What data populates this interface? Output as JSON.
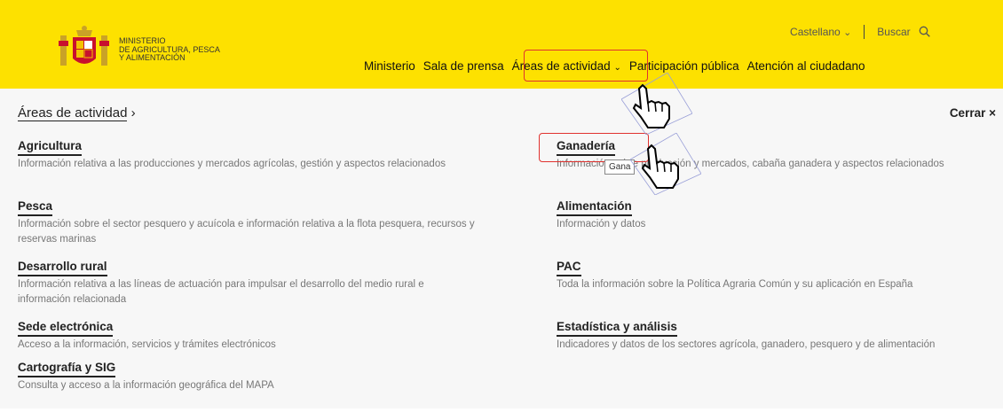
{
  "header": {
    "logo_lines": [
      "MINISTERIO",
      "DE AGRICULTURA, PESCA",
      "Y ALIMENTACIÓN"
    ],
    "language": "Castellano",
    "search": "Buscar",
    "nav": [
      "Ministerio",
      "Sala de prensa",
      "Áreas de actividad",
      "Participación pública",
      "Atención al ciudadano"
    ]
  },
  "panel": {
    "breadcrumb": "Áreas de actividad",
    "close": "Cerrar",
    "left": [
      {
        "title": "Agricultura",
        "desc": "Información relativa a las producciones y mercados agrícolas, gestión y aspectos relacionados"
      },
      {
        "title": "Pesca",
        "desc": "Información sobre el sector pesquero y acuícola e información relativa a la flota pesquera, recursos y reservas marinas"
      },
      {
        "title": "Desarrollo rural",
        "desc": "Información relativa a las líneas de actuación para impulsar el desarrollo del medio rural e información relacionada"
      },
      {
        "title": "Sede electrónica",
        "desc": "Acceso a la información, servicios y trámites electrónicos"
      },
      {
        "title": "Cartografía y SIG",
        "desc": "Consulta y acceso a la información geográfica del MAPA"
      }
    ],
    "right": [
      {
        "title": "Ganadería",
        "desc": "Información sobre producción y mercados, cabaña ganadera y aspectos relacionados"
      },
      {
        "title": "Alimentación",
        "desc": "Información y datos"
      },
      {
        "title": "PAC",
        "desc": "Toda la información sobre la Política Agraria Común y su aplicación en España"
      },
      {
        "title": "Estadística y análisis",
        "desc": "Indicadores y datos de los sectores agrícola, ganadero, pesquero y de alimentación"
      }
    ]
  },
  "tooltip": "Gana",
  "colors": {
    "brand_yellow": "#fde100",
    "highlight_red": "#e0322f"
  },
  "icons": [
    "coat-of-arms-icon",
    "chevron-down-icon",
    "search-icon",
    "chevron-right-icon",
    "close-icon",
    "hand-pointer-icon"
  ]
}
